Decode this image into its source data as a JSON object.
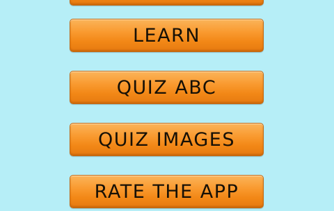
{
  "menu": {
    "top_hidden_label": "",
    "learn_label": "LEARN",
    "quiz_abc_label": "QUIZ ABC",
    "quiz_images_label": "QUIZ IMAGES",
    "rate_label": "RATE THE APP"
  },
  "colors": {
    "background": "#b6eef7",
    "button_orange": "#f99a2f",
    "button_border": "#c46a12",
    "label_text": "#161006"
  }
}
